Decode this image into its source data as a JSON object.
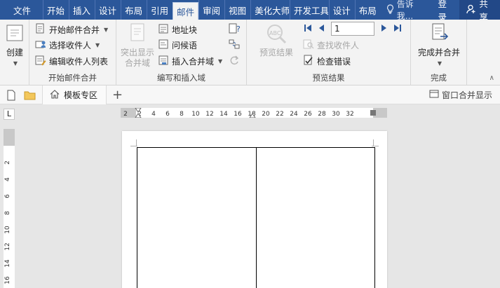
{
  "tabs": [
    {
      "label": "文件"
    },
    {
      "label": "开始"
    },
    {
      "label": "插入"
    },
    {
      "label": "设计"
    },
    {
      "label": "布局"
    },
    {
      "label": "引用"
    },
    {
      "label": "邮件",
      "active": true
    },
    {
      "label": "审阅"
    },
    {
      "label": "视图"
    },
    {
      "label": "美化大师"
    },
    {
      "label": "开发工具"
    },
    {
      "label": "设计"
    },
    {
      "label": "布局"
    }
  ],
  "tell_me": "告诉我...",
  "login": "登录",
  "share": "共享",
  "ribbon": {
    "create": {
      "label": "创建",
      "group_label": ""
    },
    "start_merge": {
      "group_label": "开始邮件合并",
      "start": "开始邮件合并",
      "select_recipients": "选择收件人",
      "edit_recipients": "编辑收件人列表"
    },
    "fields": {
      "group_label": "编写和插入域",
      "highlight_line1": "突出显示",
      "highlight_line2": "合并域",
      "address_block": "地址块",
      "greeting": "问候语",
      "insert_merge_field": "插入合并域"
    },
    "preview": {
      "group_label": "预览结果",
      "preview_results": "预览结果",
      "record_value": "1",
      "find_recipient": "查找收件人",
      "check_errors": "检查错误"
    },
    "finish": {
      "group_label": "完成",
      "finish_merge": "完成并合并"
    }
  },
  "docbar": {
    "template_tab": "模板专区",
    "add": "+",
    "window_merge": "窗口合并显示"
  },
  "ruler": {
    "tab_stop": "L",
    "h_ticks": [
      "2",
      "2",
      "4",
      "6",
      "8",
      "10",
      "12",
      "14",
      "16",
      "18",
      "20",
      "22",
      "24",
      "26",
      "28",
      "30",
      "32"
    ],
    "v_ticks": [
      "2",
      "4",
      "6",
      "8",
      "10",
      "12",
      "14",
      "16"
    ]
  },
  "colors": {
    "accent": "#2b579a",
    "ribbon": "#f3f3f3",
    "canvas": "#e6e6e6"
  }
}
